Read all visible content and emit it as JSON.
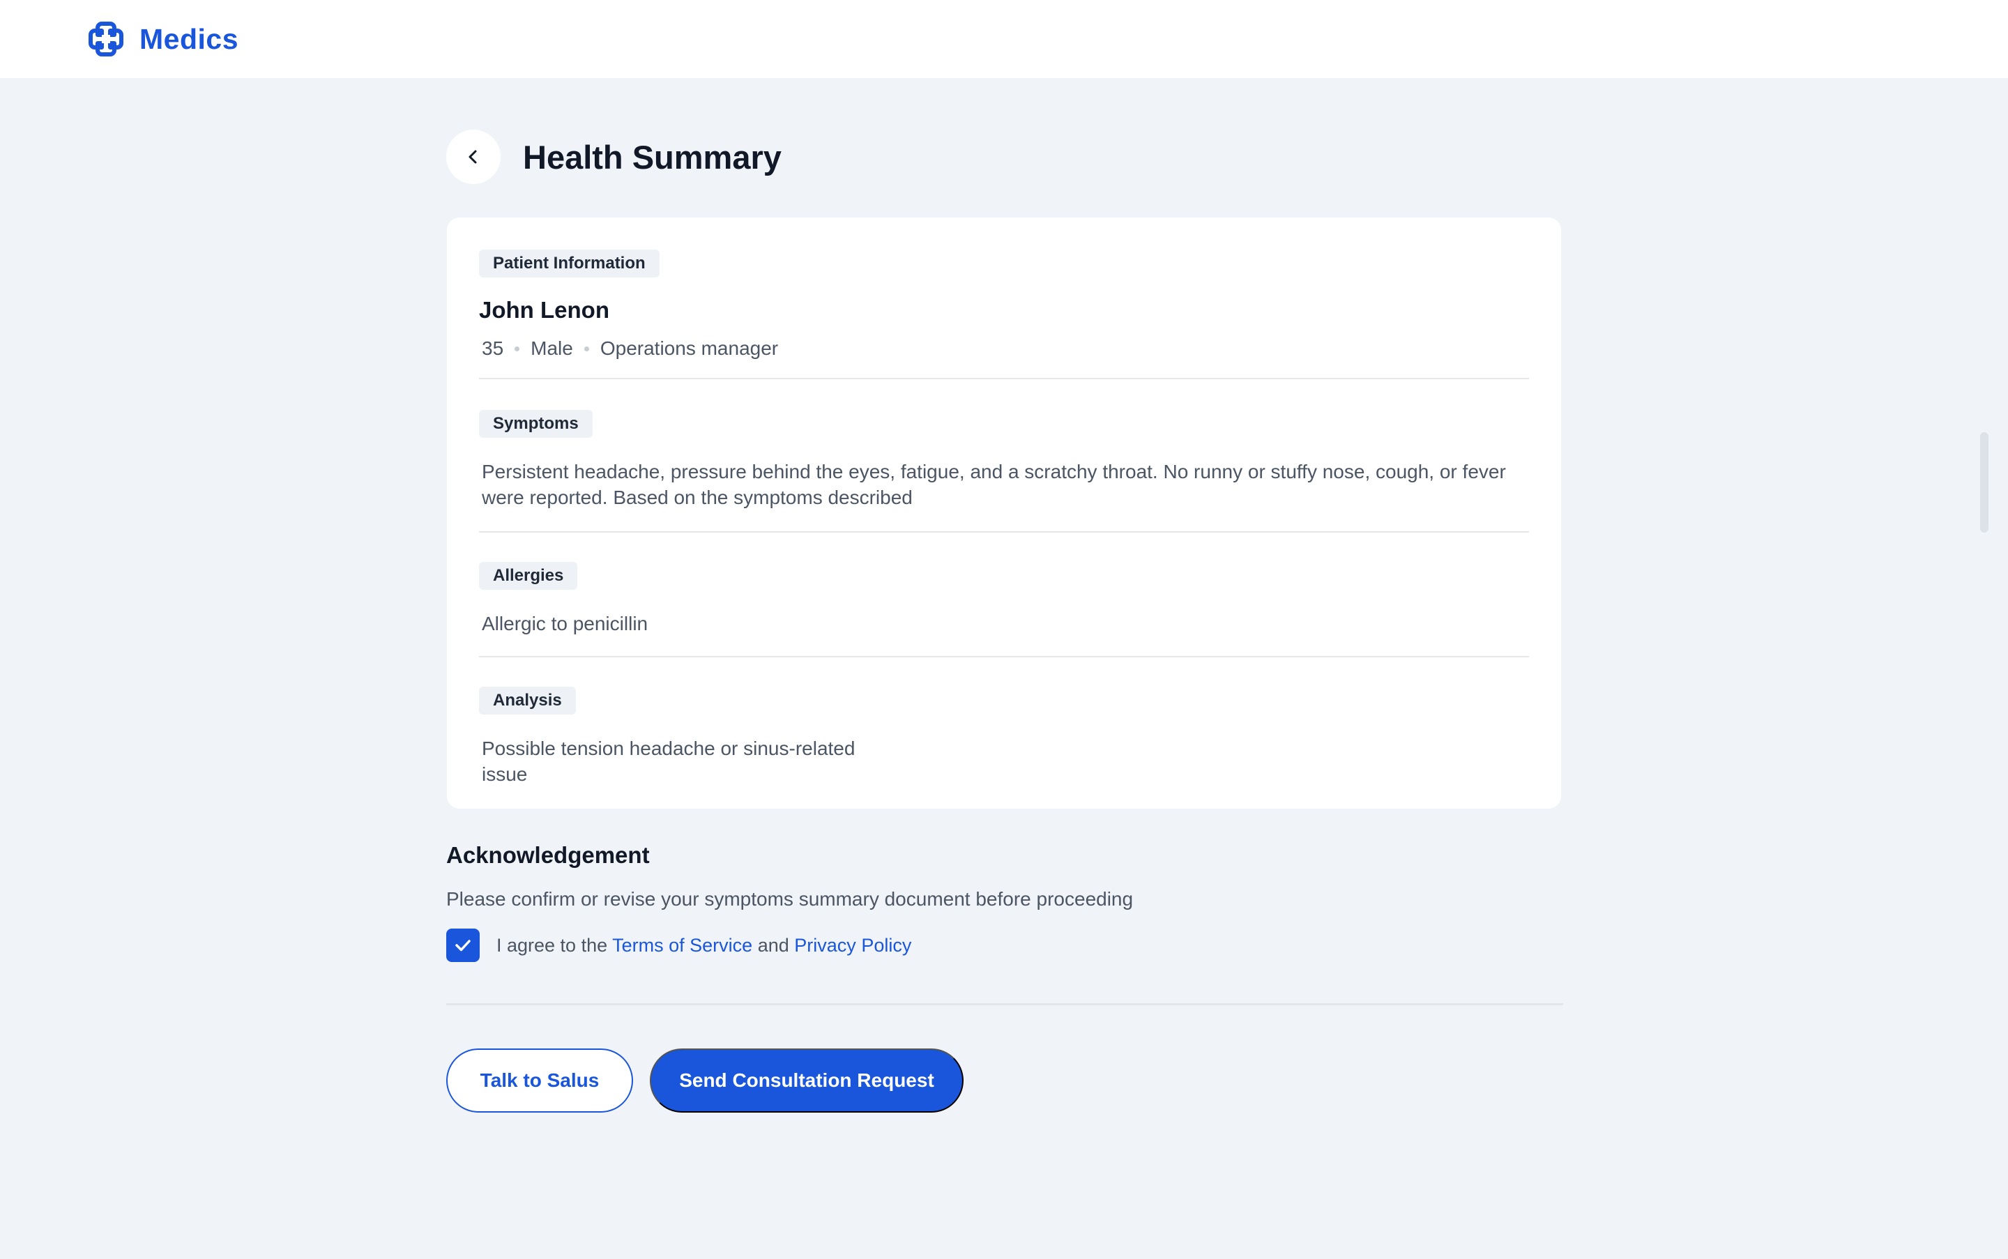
{
  "brand": {
    "name": "Medics"
  },
  "page": {
    "title": "Health Summary"
  },
  "patient": {
    "section_label": "Patient Information",
    "name": "John Lenon",
    "age": "35",
    "gender": "Male",
    "occupation": "Operations manager"
  },
  "symptoms": {
    "section_label": "Symptoms",
    "text": "Persistent headache, pressure behind the eyes, fatigue, and a scratchy throat. No runny or stuffy nose, cough, or fever were reported. Based on the symptoms described"
  },
  "allergies": {
    "section_label": "Allergies",
    "text": "Allergic to penicillin"
  },
  "analysis": {
    "section_label": "Analysis",
    "text": "Possible tension headache or sinus-related issue"
  },
  "acknowledgement": {
    "title": "Acknowledgement",
    "description": "Please confirm or revise your symptoms summary document before proceeding",
    "checked": true,
    "agree_prefix": "I agree to the",
    "terms_link": "Terms of Service",
    "and_text": "and",
    "privacy_link": "Privacy Policy"
  },
  "actions": {
    "secondary_label": "Talk to Salus",
    "primary_label": "Send Consultation Request"
  },
  "colors": {
    "accent": "#1a56db",
    "background": "#f0f4f8",
    "card": "#ffffff"
  },
  "icons": {
    "logo": "medics-logo-icon",
    "back": "chevron-left-icon",
    "check": "checkmark-icon"
  }
}
